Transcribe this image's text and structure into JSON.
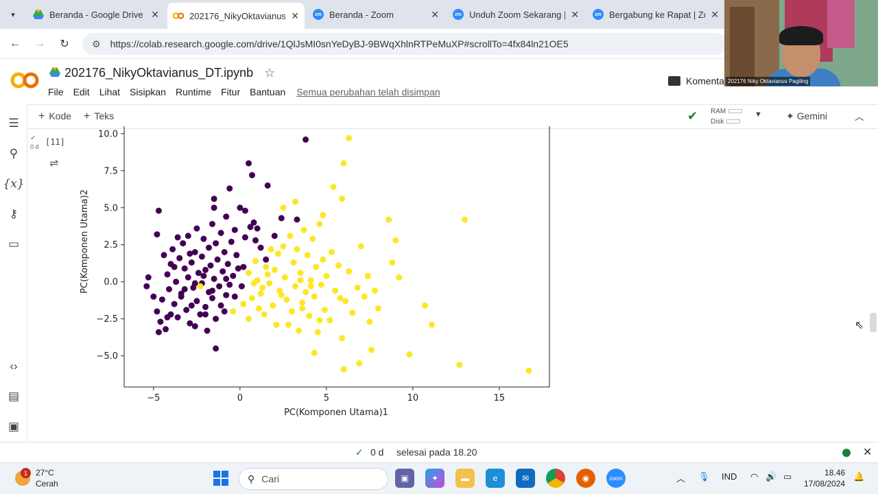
{
  "browser": {
    "tabs": [
      {
        "title": "Beranda - Google Drive",
        "icon": "google-drive-icon",
        "active": false
      },
      {
        "title": "202176_NikyOktavianus_",
        "icon": "colab-icon",
        "active": true
      },
      {
        "title": "Beranda - Zoom",
        "icon": "zoom-icon",
        "active": false
      },
      {
        "title": "Unduh Zoom Sekarang |",
        "icon": "zoom-icon",
        "active": false
      },
      {
        "title": "Bergabung ke Rapat | Zo",
        "icon": "zoom-icon",
        "active": false
      }
    ],
    "url": "https://colab.research.google.com/drive/1QlJsMI0snYeDyBJ-9BWqXhlnRTPeMuXP#scrollTo=4fx84ln21OE5"
  },
  "colab": {
    "logo_text": "CO",
    "notebook_title": "202176_NikyOktavianus_DT.ipynb",
    "menu": [
      "File",
      "Edit",
      "Lihat",
      "Sisipkan",
      "Runtime",
      "Fitur",
      "Bantuan"
    ],
    "save_status": "Semua perubahan telah disimpan",
    "comment_label": "Komenta",
    "toolbar": {
      "add_code": "Kode",
      "add_text": "Teks",
      "ram_label": "RAM",
      "disk_label": "Disk",
      "gemini_label": "Gemini"
    },
    "cell": {
      "exec_count": "[11]",
      "exec_time": "0 d"
    },
    "status": {
      "duration": "0 d",
      "finished": "selesai pada 18.20"
    }
  },
  "chart_data": {
    "type": "scatter",
    "xlabel": "PC(Komponen Utama)1",
    "ylabel": "PC(Komponen Utama)2",
    "xlim": [
      -6.7,
      17.9
    ],
    "ylim": [
      -7.1,
      10.5
    ],
    "xticks": [
      -5,
      0,
      5,
      10,
      15
    ],
    "yticks": [
      -5.0,
      -2.5,
      0.0,
      2.5,
      5.0,
      7.5,
      10.0
    ],
    "xtick_labels": [
      "−5",
      "0",
      "5",
      "10",
      "15"
    ],
    "ytick_labels": [
      "−5.0",
      "−2.5",
      "0.0",
      "2.5",
      "5.0",
      "7.5",
      "10.0"
    ],
    "series": [
      {
        "color": "#440154",
        "points": [
          [
            -5.3,
            0.3
          ],
          [
            -5.4,
            -0.3
          ],
          [
            -5.0,
            -1.0
          ],
          [
            -4.7,
            4.8
          ],
          [
            -4.8,
            3.2
          ],
          [
            -4.5,
            -1.2
          ],
          [
            -4.8,
            -2.0
          ],
          [
            -4.6,
            -2.7
          ],
          [
            -4.7,
            -3.4
          ],
          [
            -4.3,
            -3.2
          ],
          [
            -4.2,
            0.5
          ],
          [
            -4.1,
            -0.5
          ],
          [
            -4.0,
            1.2
          ],
          [
            -3.9,
            2.2
          ],
          [
            -3.8,
            -1.5
          ],
          [
            -3.7,
            0.0
          ],
          [
            -3.6,
            -2.4
          ],
          [
            -3.5,
            1.6
          ],
          [
            -3.4,
            -0.8
          ],
          [
            -3.3,
            2.6
          ],
          [
            -3.2,
            0.9
          ],
          [
            -3.1,
            -1.9
          ],
          [
            -3.0,
            3.1
          ],
          [
            -3.0,
            0.3
          ],
          [
            -2.9,
            -2.8
          ],
          [
            -2.8,
            1.3
          ],
          [
            -2.7,
            -0.4
          ],
          [
            -2.6,
            2.0
          ],
          [
            -2.5,
            -1.3
          ],
          [
            -2.5,
            3.6
          ],
          [
            -2.4,
            0.6
          ],
          [
            -2.3,
            -2.2
          ],
          [
            -2.2,
            1.7
          ],
          [
            -2.2,
            -0.1
          ],
          [
            -2.1,
            2.9
          ],
          [
            -2.0,
            -1.7
          ],
          [
            -2.0,
            0.8
          ],
          [
            -1.9,
            -3.3
          ],
          [
            -1.8,
            2.3
          ],
          [
            -1.8,
            -0.7
          ],
          [
            -1.7,
            1.1
          ],
          [
            -1.6,
            3.9
          ],
          [
            -1.6,
            -1.1
          ],
          [
            -1.5,
            0.2
          ],
          [
            -1.4,
            2.6
          ],
          [
            -1.4,
            -2.5
          ],
          [
            -1.3,
            1.5
          ],
          [
            -1.2,
            -0.3
          ],
          [
            -1.1,
            3.3
          ],
          [
            -1.1,
            -1.6
          ],
          [
            -1.0,
            0.7
          ],
          [
            -0.9,
            2.0
          ],
          [
            -0.8,
            -0.9
          ],
          [
            -0.8,
            4.4
          ],
          [
            -0.7,
            1.2
          ],
          [
            -0.6,
            -0.2
          ],
          [
            -0.5,
            2.7
          ],
          [
            -0.4,
            0.4
          ],
          [
            -0.3,
            -1.0
          ],
          [
            -0.2,
            1.8
          ],
          [
            -1.5,
            5.0
          ],
          [
            -1.5,
            5.6
          ],
          [
            -0.6,
            6.3
          ],
          [
            0.5,
            8.0
          ],
          [
            0.7,
            7.2
          ],
          [
            0.6,
            3.7
          ],
          [
            1.2,
            2.3
          ],
          [
            1.6,
            6.5
          ],
          [
            0.8,
            4.0
          ],
          [
            1.0,
            3.6
          ],
          [
            3.8,
            9.6
          ],
          [
            2.0,
            3.1
          ],
          [
            1.5,
            1.5
          ],
          [
            0.9,
            2.8
          ],
          [
            0.3,
            3.0
          ],
          [
            -3.4,
            -1.0
          ],
          [
            -2.6,
            -3.0
          ],
          [
            -1.4,
            -4.5
          ],
          [
            -4.0,
            -2.2
          ],
          [
            -3.6,
            3.0
          ],
          [
            0.3,
            4.8
          ],
          [
            0.0,
            5.0
          ],
          [
            0.2,
            1.0
          ],
          [
            0.1,
            -0.3
          ],
          [
            -0.1,
            0.9
          ],
          [
            2.4,
            4.3
          ],
          [
            3.3,
            4.2
          ],
          [
            -0.3,
            3.5
          ],
          [
            -2.9,
            1.9
          ],
          [
            -3.8,
            1.0
          ],
          [
            -4.4,
            1.8
          ],
          [
            -4.2,
            -2.4
          ],
          [
            -2.0,
            -2.2
          ],
          [
            -0.9,
            -2.0
          ],
          [
            -2.6,
            -0.1
          ],
          [
            -2.1,
            0.4
          ],
          [
            -1.6,
            -0.6
          ],
          [
            -0.8,
            0.2
          ],
          [
            -3.2,
            -0.5
          ],
          [
            -2.8,
            -1.6
          ]
        ]
      },
      {
        "color": "#fde725",
        "points": [
          [
            -2.3,
            -0.3
          ],
          [
            0.2,
            -1.5
          ],
          [
            -0.4,
            -2.0
          ],
          [
            0.5,
            -2.5
          ],
          [
            0.7,
            -1.1
          ],
          [
            1.0,
            0.1
          ],
          [
            1.2,
            -0.8
          ],
          [
            1.4,
            -2.2
          ],
          [
            1.5,
            1.0
          ],
          [
            1.7,
            -0.1
          ],
          [
            1.9,
            -1.6
          ],
          [
            2.0,
            0.8
          ],
          [
            2.1,
            -2.9
          ],
          [
            2.2,
            1.9
          ],
          [
            2.3,
            -0.6
          ],
          [
            2.5,
            2.4
          ],
          [
            2.6,
            0.3
          ],
          [
            2.7,
            -1.2
          ],
          [
            2.9,
            3.1
          ],
          [
            3.0,
            -2.0
          ],
          [
            3.1,
            1.3
          ],
          [
            3.2,
            -0.3
          ],
          [
            3.3,
            2.2
          ],
          [
            3.4,
            -3.3
          ],
          [
            3.5,
            0.6
          ],
          [
            3.6,
            -1.4
          ],
          [
            3.7,
            3.5
          ],
          [
            3.8,
            -0.7
          ],
          [
            3.9,
            1.8
          ],
          [
            4.0,
            -2.3
          ],
          [
            4.1,
            0.1
          ],
          [
            4.2,
            2.9
          ],
          [
            4.3,
            -1.0
          ],
          [
            4.4,
            1.0
          ],
          [
            4.5,
            -3.4
          ],
          [
            4.6,
            3.9
          ],
          [
            4.7,
            -0.2
          ],
          [
            4.8,
            1.5
          ],
          [
            4.9,
            -1.9
          ],
          [
            5.0,
            0.4
          ],
          [
            5.2,
            -2.6
          ],
          [
            5.3,
            2.0
          ],
          [
            5.5,
            -0.6
          ],
          [
            5.7,
            1.1
          ],
          [
            5.9,
            -3.8
          ],
          [
            6.1,
            -1.3
          ],
          [
            6.3,
            0.7
          ],
          [
            6.5,
            -2.1
          ],
          [
            6.8,
            -0.4
          ],
          [
            7.0,
            2.4
          ],
          [
            7.2,
            -1.0
          ],
          [
            7.4,
            0.4
          ],
          [
            7.6,
            -4.6
          ],
          [
            7.8,
            -0.6
          ],
          [
            8.0,
            -1.8
          ],
          [
            8.6,
            4.2
          ],
          [
            8.8,
            1.3
          ],
          [
            9.0,
            2.8
          ],
          [
            9.2,
            0.3
          ],
          [
            9.8,
            -4.9
          ],
          [
            10.7,
            -1.6
          ],
          [
            11.1,
            -2.9
          ],
          [
            13.0,
            4.2
          ],
          [
            12.7,
            -5.6
          ],
          [
            16.7,
            -6.0
          ],
          [
            6.0,
            8.0
          ],
          [
            6.3,
            9.7
          ],
          [
            5.4,
            6.4
          ],
          [
            5.9,
            5.6
          ],
          [
            4.8,
            4.5
          ],
          [
            3.2,
            5.4
          ],
          [
            2.5,
            5.0
          ],
          [
            1.8,
            2.2
          ],
          [
            1.3,
            -0.4
          ],
          [
            0.8,
            -0.1
          ],
          [
            0.5,
            0.6
          ],
          [
            0.9,
            1.4
          ],
          [
            1.1,
            -1.8
          ],
          [
            3.6,
            -1.8
          ],
          [
            4.6,
            -2.6
          ],
          [
            5.8,
            -1.1
          ],
          [
            6.9,
            -5.5
          ],
          [
            7.5,
            -2.7
          ],
          [
            4.3,
            -4.8
          ],
          [
            6.0,
            -5.9
          ],
          [
            2.8,
            -2.9
          ],
          [
            3.5,
            0.1
          ],
          [
            4.1,
            -0.3
          ],
          [
            2.4,
            -0.9
          ],
          [
            1.6,
            0.5
          ]
        ]
      }
    ]
  },
  "taskbar": {
    "temperature": "27°C",
    "weather": "Cerah",
    "notification_count": "1",
    "search_placeholder": "Cari",
    "language": "IND",
    "time": "18.46",
    "date": "17/08/2024"
  },
  "webcam": {
    "participant_name": "202176 Niky Oktavianus Pagiling"
  }
}
